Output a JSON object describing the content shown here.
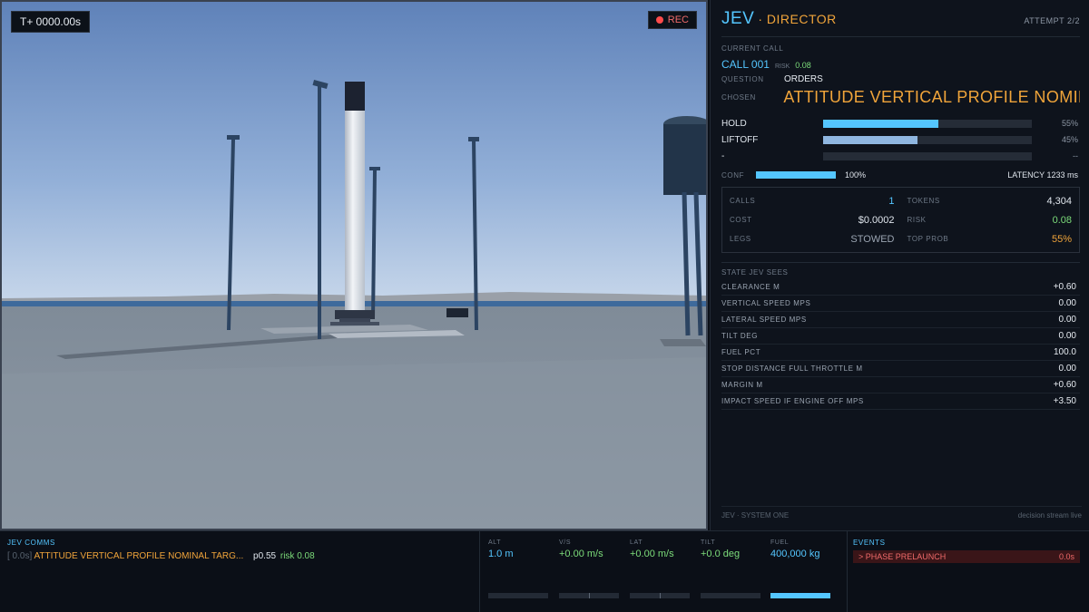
{
  "viewport": {
    "timer": "T+ 0000.00s",
    "rec_label": "REC"
  },
  "panel": {
    "title": "JEV",
    "subtitle": "· DIRECTOR",
    "attempt": "ATTEMPT 2/2",
    "current_call_label": "CURRENT CALL",
    "call_id": "CALL 001",
    "risk_label": "RISK",
    "risk_value": "0.08",
    "question_label": "QUESTION",
    "question_value": "ORDERS",
    "chosen_label": "CHOSEN",
    "chosen_value": "ATTITUDE VERTICAL  PROFILE NOMINAL",
    "options": [
      {
        "label": "HOLD",
        "prob": "55%",
        "fraction": 0.55,
        "color": "#54c6ff"
      },
      {
        "label": "LIFTOFF",
        "prob": "45%",
        "fraction": 0.45,
        "color": "#8fb6e0"
      },
      {
        "label": "-",
        "prob": "--",
        "fraction": 0,
        "color": "#8fb6e0"
      }
    ],
    "conf_label": "CONF",
    "conf_value": "100%",
    "latency": "LATENCY 1233 ms",
    "stats": {
      "calls_label": "CALLS",
      "calls": "1",
      "tokens_label": "TOKENS",
      "tokens": "4,304",
      "cost_label": "COST",
      "cost": "$0.0002",
      "risk_label": "RISK",
      "risk": "0.08",
      "legs_label": "LEGS",
      "legs": "STOWED",
      "top_prob_label": "TOP PROB",
      "top_prob": "55%"
    },
    "state_title": "STATE JEV SEES",
    "state_rows": [
      {
        "label": "CLEARANCE M",
        "value": "+0.60"
      },
      {
        "label": "VERTICAL SPEED MPS",
        "value": "0.00"
      },
      {
        "label": "LATERAL SPEED MPS",
        "value": "0.00"
      },
      {
        "label": "TILT DEG",
        "value": "0.00"
      },
      {
        "label": "FUEL PCT",
        "value": "100.0"
      },
      {
        "label": "STOP DISTANCE FULL THROTTLE M",
        "value": "0.00"
      },
      {
        "label": "MARGIN M",
        "value": "+0.60"
      },
      {
        "label": "IMPACT SPEED IF ENGINE OFF MPS",
        "value": "+3.50"
      }
    ],
    "footer_left": "JEV · SYSTEM ONE",
    "footer_right": "decision stream live"
  },
  "comms": {
    "title": "JEV COMMS",
    "time": "[ 0.0s]",
    "message": "ATTITUDE VERTICAL  PROFILE NOMINAL  TARG...",
    "prob": "p0.55",
    "risk": "risk 0.08"
  },
  "telemetry": [
    {
      "label": "ALT",
      "value": "1.0 m",
      "color": "#54c6ff"
    },
    {
      "label": "V/S",
      "value": "+0.00 m/s",
      "color": "#7cdc7a"
    },
    {
      "label": "LAT",
      "value": "+0.00 m/s",
      "color": "#7cdc7a"
    },
    {
      "label": "TILT",
      "value": "+0.0 deg",
      "color": "#7cdc7a"
    },
    {
      "label": "FUEL",
      "value": "400,000 kg",
      "color": "#54c6ff"
    }
  ],
  "events": {
    "title": "EVENTS",
    "items": [
      {
        "label": "> PHASE PRELAUNCH",
        "time": "0.0s"
      }
    ]
  },
  "colors": {
    "accent": "#54c6ff",
    "director": "#f0a43a",
    "good": "#7cdc7a",
    "alert": "#f06a6a"
  }
}
